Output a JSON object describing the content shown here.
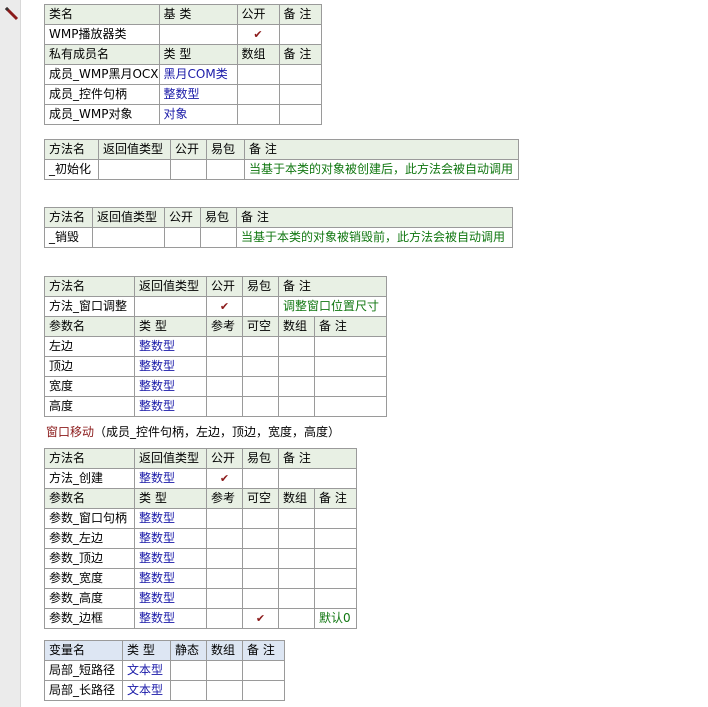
{
  "class_table": {
    "headers": [
      "类名",
      "基 类",
      "公开",
      "备 注"
    ],
    "row": {
      "name": "WMP播放器类",
      "base": "",
      "public_check": "✔",
      "note": ""
    }
  },
  "member_table": {
    "headers": [
      "私有成员名",
      "类 型",
      "数组",
      "备 注"
    ],
    "rows": [
      {
        "name": "成员_WMP黑月OCX",
        "type": "黑月COM类"
      },
      {
        "name": "成员_控件句柄",
        "type": "整数型"
      },
      {
        "name": "成员_WMP对象",
        "type": "对象"
      }
    ]
  },
  "method_init": {
    "headers": [
      "方法名",
      "返回值类型",
      "公开",
      "易包",
      "备 注"
    ],
    "name": "_初始化",
    "note": "当基于本类的对象被创建后，此方法会被自动调用"
  },
  "method_destroy": {
    "headers": [
      "方法名",
      "返回值类型",
      "公开",
      "易包",
      "备 注"
    ],
    "name": "_销毁",
    "note": "当基于本类的对象被销毁前，此方法会被自动调用"
  },
  "method_resize": {
    "headers": [
      "方法名",
      "返回值类型",
      "公开",
      "易包",
      "备 注"
    ],
    "name": "方法_窗口调整",
    "public_check": "✔",
    "note": "调整窗口位置尺寸",
    "param_headers": [
      "参数名",
      "类 型",
      "参考",
      "可空",
      "数组",
      "备 注"
    ],
    "params": [
      {
        "name": "左边",
        "type": "整数型"
      },
      {
        "name": "顶边",
        "type": "整数型"
      },
      {
        "name": "宽度",
        "type": "整数型"
      },
      {
        "name": "高度",
        "type": "整数型"
      }
    ]
  },
  "code_line": {
    "fn": "窗口移动",
    "args": "（成员_控件句柄，左边，顶边，宽度，高度）"
  },
  "method_create": {
    "headers": [
      "方法名",
      "返回值类型",
      "公开",
      "易包",
      "备 注"
    ],
    "name": "方法_创建",
    "return_type": "整数型",
    "public_check": "✔",
    "param_headers": [
      "参数名",
      "类 型",
      "参考",
      "可空",
      "数组",
      "备 注"
    ],
    "params": [
      {
        "name": "参数_窗口句柄",
        "type": "整数型",
        "nullable": "",
        "note": ""
      },
      {
        "name": "参数_左边",
        "type": "整数型",
        "nullable": "",
        "note": ""
      },
      {
        "name": "参数_顶边",
        "type": "整数型",
        "nullable": "",
        "note": ""
      },
      {
        "name": "参数_宽度",
        "type": "整数型",
        "nullable": "",
        "note": ""
      },
      {
        "name": "参数_高度",
        "type": "整数型",
        "nullable": "",
        "note": ""
      },
      {
        "name": "参数_边框",
        "type": "整数型",
        "nullable": "✔",
        "note": "默认0"
      }
    ]
  },
  "local_vars": {
    "headers": [
      "变量名",
      "类 型",
      "静态",
      "数组",
      "备 注"
    ],
    "rows": [
      {
        "name": "局部_短路径",
        "type": "文本型"
      },
      {
        "name": "局部_长路径",
        "type": "文本型"
      }
    ]
  }
}
